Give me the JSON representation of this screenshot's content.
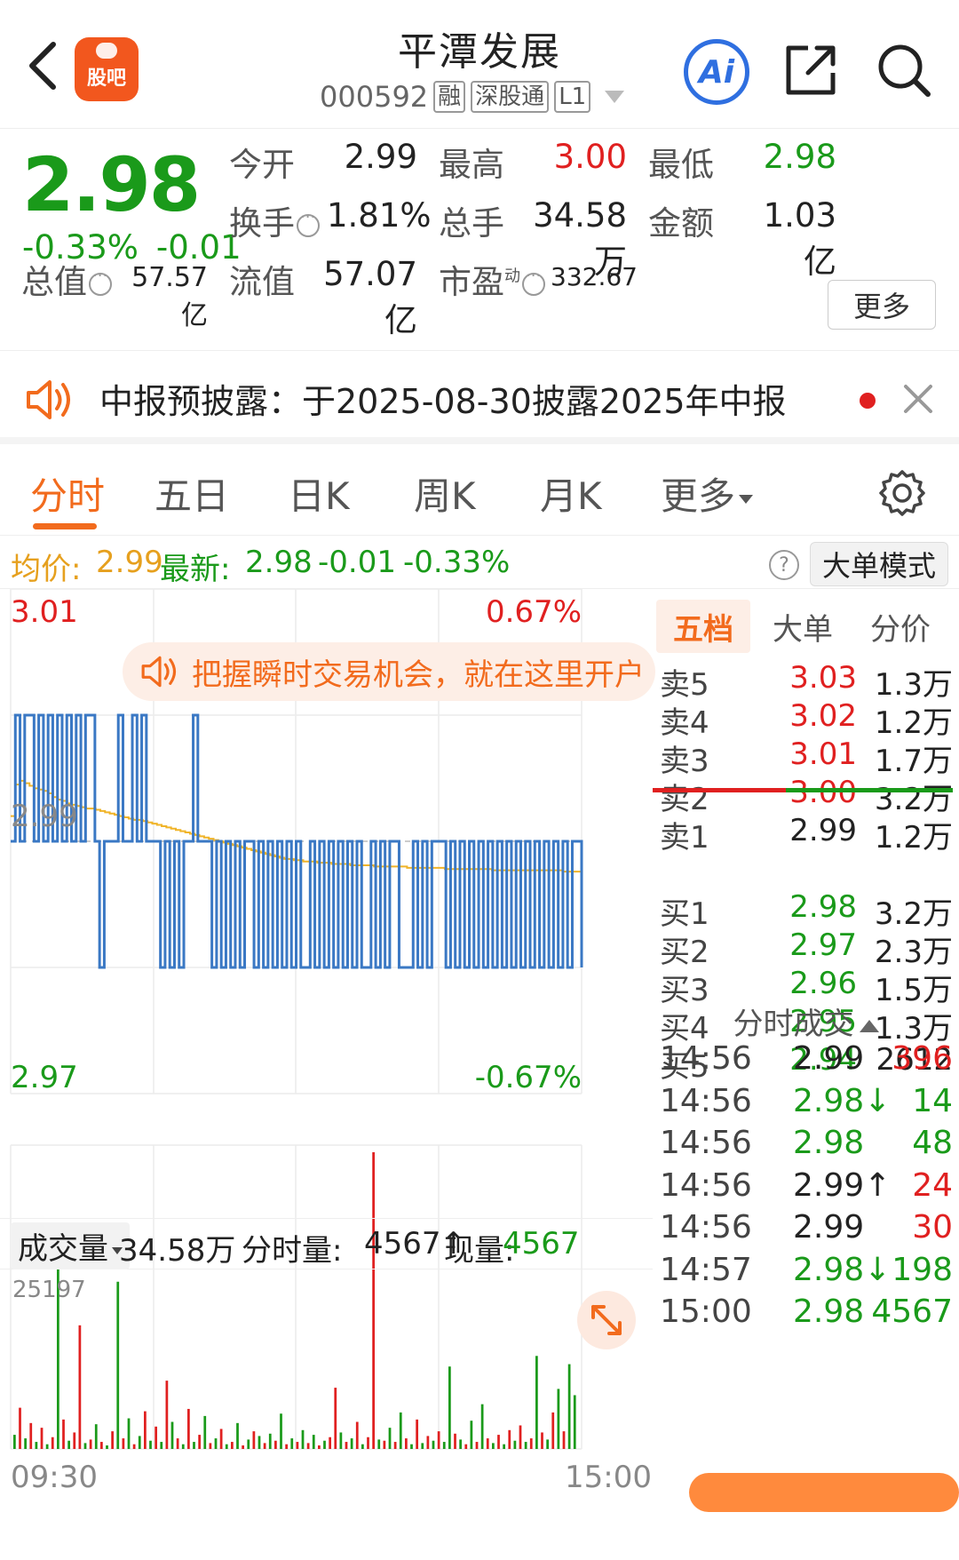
{
  "header": {
    "title": "平潭发展",
    "code": "000592",
    "tags": [
      "融",
      "深股通",
      "L1"
    ],
    "logo_text": "股吧",
    "ai_label": "Ai"
  },
  "quote": {
    "price": "2.98",
    "change_pct": "-0.33%",
    "change": "-0.01",
    "open_label": "今开",
    "open": "2.99",
    "high_label": "最高",
    "high": "3.00",
    "low_label": "最低",
    "low": "2.98",
    "turnover_label": "换手",
    "turnover": "1.81%",
    "volume_label": "总手",
    "volume": "34.58万",
    "amount_label": "金额",
    "amount": "1.03亿",
    "mktcap_label": "总值",
    "mktcap": "57.57亿",
    "float_label": "流值",
    "float": "57.07亿",
    "pe_label": "市盈",
    "pe_sup": "动",
    "pe": "332.67",
    "more_label": "更多"
  },
  "notice": {
    "text": "中报预披露：于2025-08-30披露2025年中报"
  },
  "tabs": [
    "分时",
    "五日",
    "日K",
    "周K",
    "月K",
    "更多"
  ],
  "avg_row": {
    "avg_label": "均价:",
    "avg": "2.99",
    "latest_label": "最新:",
    "latest": "2.98",
    "change": "-0.01",
    "change_pct": "-0.33%",
    "help": "?",
    "big_order_label": "大单模式"
  },
  "chart": {
    "y_top": "3.01",
    "y_mid": "2.99",
    "y_bottom": "2.97",
    "pct_top": "0.67%",
    "pct_bottom": "-0.67%",
    "promo_text": "把握瞬时交易机会，就在这里开户",
    "vol_selector": "成交量",
    "vol_total": "34.58万",
    "tick_vol_label": "分时量:",
    "tick_vol": "4567↑",
    "cur_vol_label": "现量:",
    "cur_vol": "4567",
    "vol_max": "25197",
    "time_start": "09:30",
    "time_end": "15:00",
    "colors": {
      "price": "#3a78c4",
      "avg": "#f0b429",
      "up": "#e02020",
      "down": "#1a9a1a"
    }
  },
  "chart_data": {
    "type": "line",
    "ylim": [
      2.97,
      3.01
    ],
    "series": [
      {
        "values": [
          2.99,
          3.0,
          2.99,
          3.0,
          3.0,
          2.99,
          3.0,
          2.99,
          3.0,
          2.99,
          3.0,
          2.99,
          3.0,
          2.99,
          3.0,
          2.99,
          3.0,
          3.0,
          2.99,
          2.98,
          2.99,
          2.99,
          2.99,
          3.0,
          2.99,
          2.99,
          3.0,
          2.99,
          3.0,
          2.99,
          2.99,
          2.99,
          2.98,
          2.99,
          2.98,
          2.99,
          2.98,
          2.99,
          2.99,
          3.0,
          2.99,
          2.99,
          2.99,
          2.98,
          2.99,
          2.98,
          2.99,
          2.98,
          2.99,
          2.98,
          2.99,
          2.99,
          2.98,
          2.99,
          2.98,
          2.99,
          2.98,
          2.99,
          2.98,
          2.99,
          2.98,
          2.99,
          2.98,
          2.98,
          2.99,
          2.98,
          2.99,
          2.98,
          2.99,
          2.98,
          2.99,
          2.98,
          2.99,
          2.98,
          2.99,
          2.98,
          2.98,
          2.99,
          2.98,
          2.99,
          2.98,
          2.99,
          2.99,
          2.98,
          2.98,
          2.98,
          2.99,
          2.98,
          2.99,
          2.98,
          2.99,
          2.99,
          2.99,
          2.98,
          2.99,
          2.98,
          2.99,
          2.98,
          2.99,
          2.98,
          2.99,
          2.98,
          2.99,
          2.98,
          2.99,
          2.98,
          2.99,
          2.98,
          2.99,
          2.98,
          2.99,
          2.98,
          2.99,
          2.98,
          2.99,
          2.98,
          2.99,
          2.98,
          2.99,
          2.98,
          2.99,
          2.99,
          2.98
        ]
      },
      {
        "values": [
          2.992,
          2.9945,
          2.9948,
          2.9946,
          2.9944,
          2.9942,
          2.9941,
          2.994,
          2.9938,
          2.9935,
          2.9933,
          2.9932,
          2.993,
          2.9929,
          2.9928,
          2.9927,
          2.9926,
          2.9926,
          2.9925,
          2.9924,
          2.9923,
          2.9922,
          2.9921,
          2.992,
          2.9919,
          2.9918,
          2.9917,
          2.9917,
          2.9916,
          2.9915,
          2.9914,
          2.9913,
          2.9912,
          2.9911,
          2.991,
          2.9909,
          2.9908,
          2.9907,
          2.9906,
          2.9905,
          2.9904,
          2.9903,
          2.9902,
          2.9901,
          2.99,
          2.9899,
          2.9898,
          2.9897,
          2.9896,
          2.9895,
          2.9894,
          2.9893,
          2.9892,
          2.9891,
          2.989,
          2.9889,
          2.9888,
          2.9887,
          2.9886,
          2.9886,
          2.9885,
          2.9885,
          2.9884,
          2.9884,
          2.9884,
          2.9883,
          2.9883,
          2.9883,
          2.9882,
          2.9882,
          2.9882,
          2.9882,
          2.9881,
          2.9881,
          2.9881,
          2.9881,
          2.9881,
          2.988,
          2.988,
          2.988,
          2.988,
          2.988,
          2.988,
          2.988,
          2.9879,
          2.9879,
          2.9879,
          2.9879,
          2.9879,
          2.9879,
          2.9879,
          2.9879,
          2.9878,
          2.9878,
          2.9878,
          2.9878,
          2.9878,
          2.9878,
          2.9878,
          2.9878,
          2.9878,
          2.9878,
          2.9877,
          2.9877,
          2.9877,
          2.9877,
          2.9877,
          2.9877,
          2.9877,
          2.9877,
          2.9877,
          2.9877,
          2.9877,
          2.9877,
          2.9877,
          2.9877,
          2.9877,
          2.9876,
          2.9876,
          2.9876,
          2.9876,
          2.9876
        ]
      }
    ],
    "volume_ylim": [
      0,
      25197
    ],
    "volume": [
      1200,
      3500,
      900,
      2200,
      600,
      1800,
      400,
      1000,
      15800,
      2500,
      700,
      1400,
      10500,
      500,
      800,
      2100,
      600,
      300,
      1500,
      14200,
      900,
      2600,
      400,
      1100,
      3200,
      700,
      1900,
      600,
      5800,
      2300,
      900,
      400,
      3400,
      600,
      1200,
      2800,
      500,
      900,
      1700,
      400,
      600,
      2200,
      300,
      800,
      1500,
      1100,
      500,
      1300,
      700,
      3000,
      400,
      900,
      600,
      1600,
      500,
      1200,
      300,
      700,
      1000,
      5200,
      1400,
      600,
      900,
      2300,
      400,
      1000,
      25197,
      800,
      700,
      1800,
      600,
      3100,
      900,
      400,
      2500,
      500,
      1100,
      700,
      1500,
      600,
      7000,
      1300,
      800,
      400,
      2400,
      600,
      3800,
      900,
      500,
      1200,
      400,
      1600,
      700,
      2000,
      600,
      900,
      7900,
      1400,
      800,
      3100,
      5100,
      1500,
      7200,
      4567
    ],
    "volume_colors": [
      "down",
      "up",
      "down",
      "up",
      "down",
      "up",
      "down",
      "up",
      "down",
      "up",
      "down",
      "up",
      "up",
      "down",
      "up",
      "down",
      "up",
      "down",
      "up",
      "down",
      "up",
      "down",
      "up",
      "down",
      "up",
      "down",
      "up",
      "down",
      "up",
      "down",
      "up",
      "down",
      "up",
      "down",
      "up",
      "down",
      "up",
      "down",
      "up",
      "down",
      "up",
      "down",
      "up",
      "down",
      "up",
      "down",
      "up",
      "down",
      "up",
      "down",
      "up",
      "down",
      "up",
      "down",
      "up",
      "down",
      "up",
      "down",
      "up",
      "up",
      "down",
      "up",
      "down",
      "up",
      "down",
      "up",
      "up",
      "down",
      "up",
      "down",
      "up",
      "down",
      "up",
      "down",
      "up",
      "down",
      "up",
      "down",
      "up",
      "down",
      "down",
      "up",
      "down",
      "up",
      "down",
      "up",
      "down",
      "up",
      "down",
      "up",
      "down",
      "up",
      "down",
      "up",
      "down",
      "up",
      "down",
      "up",
      "down",
      "up",
      "down",
      "up",
      "down",
      "down"
    ]
  },
  "book": {
    "tabs": [
      "五档",
      "大单",
      "分价"
    ],
    "asks": [
      {
        "label": "卖5",
        "price": "3.03",
        "vol": "1.3万",
        "color": "red"
      },
      {
        "label": "卖4",
        "price": "3.02",
        "vol": "1.2万",
        "color": "red"
      },
      {
        "label": "卖3",
        "price": "3.01",
        "vol": "1.7万",
        "color": "red"
      },
      {
        "label": "卖2",
        "price": "3.00",
        "vol": "3.2万",
        "color": "red"
      },
      {
        "label": "卖1",
        "price": "2.99",
        "vol": "1.2万",
        "color": "black"
      }
    ],
    "bids": [
      {
        "label": "买1",
        "price": "2.98",
        "vol": "3.2万",
        "color": "green"
      },
      {
        "label": "买2",
        "price": "2.97",
        "vol": "2.3万",
        "color": "green"
      },
      {
        "label": "买3",
        "price": "2.96",
        "vol": "1.5万",
        "color": "green"
      },
      {
        "label": "买4",
        "price": "2.95",
        "vol": "1.3万",
        "color": "green"
      },
      {
        "label": "买5",
        "price": "2.94",
        "vol": "2612",
        "color": "green"
      }
    ],
    "trades_title": "分时成交",
    "trades": [
      {
        "time": "14:56",
        "price": "2.99",
        "vol": "396",
        "pcolor": "black",
        "vcolor": "red"
      },
      {
        "time": "14:56",
        "price": "2.98↓",
        "vol": "14",
        "pcolor": "green",
        "vcolor": "green"
      },
      {
        "time": "14:56",
        "price": "2.98",
        "vol": "48",
        "pcolor": "green",
        "vcolor": "green"
      },
      {
        "time": "14:56",
        "price": "2.99↑",
        "vol": "24",
        "pcolor": "black",
        "vcolor": "red"
      },
      {
        "time": "14:56",
        "price": "2.99",
        "vol": "30",
        "pcolor": "black",
        "vcolor": "red"
      },
      {
        "time": "14:57",
        "price": "2.98↓",
        "vol": "198",
        "pcolor": "green",
        "vcolor": "green"
      },
      {
        "time": "15:00",
        "price": "2.98",
        "vol": "4567",
        "pcolor": "green",
        "vcolor": "green"
      }
    ]
  }
}
